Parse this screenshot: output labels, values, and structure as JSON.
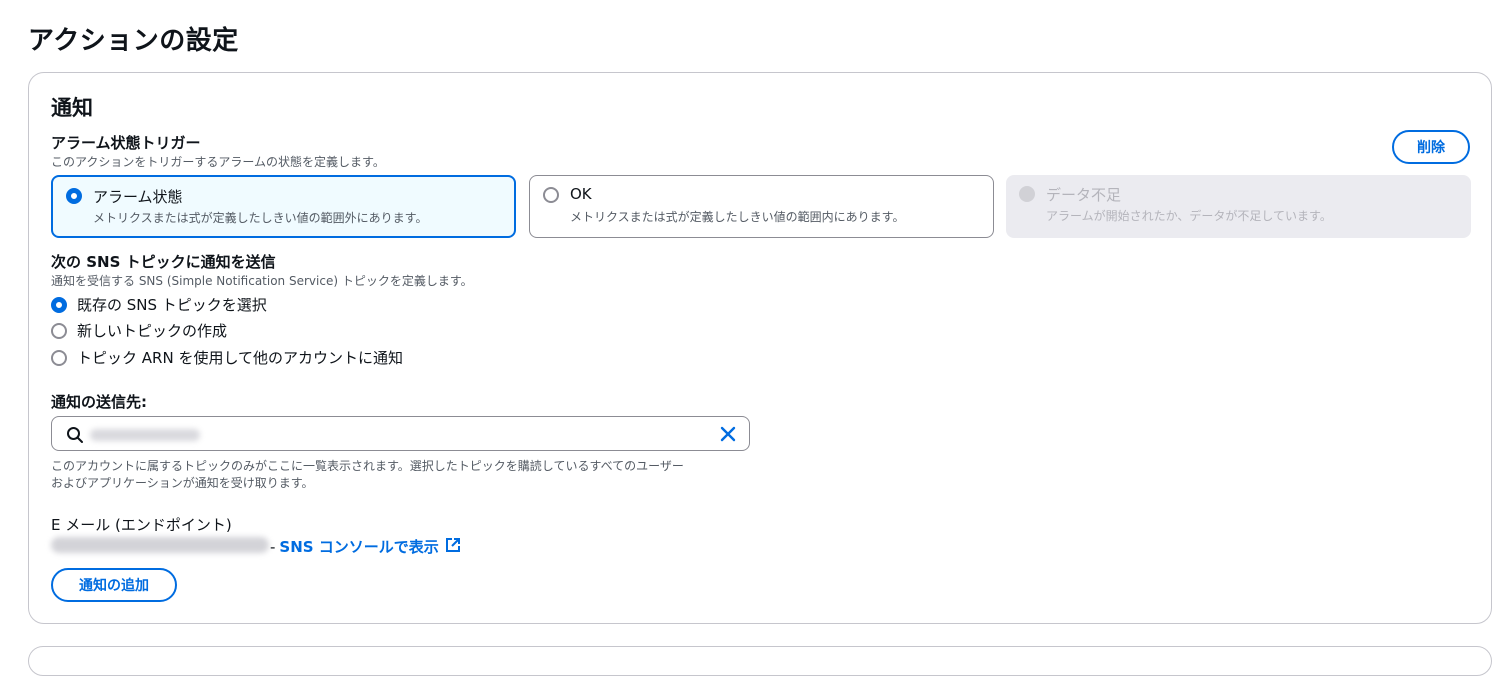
{
  "page": {
    "title": "アクションの設定"
  },
  "notification": {
    "title": "通知",
    "delete_label": "削除",
    "trigger": {
      "label": "アラーム状態トリガー",
      "description": "このアクションをトリガーするアラームの状態を定義します。",
      "options": [
        {
          "title": "アラーム状態",
          "description": "メトリクスまたは式が定義したしきい値の範囲外にあります。",
          "state": "selected"
        },
        {
          "title": "OK",
          "description": "メトリクスまたは式が定義したしきい値の範囲内にあります。",
          "state": "unselected"
        },
        {
          "title": "データ不足",
          "description": "アラームが開始されたか、データが不足しています。",
          "state": "disabled"
        }
      ]
    },
    "sns": {
      "label": "次の SNS トピックに通知を送信",
      "description": "通知を受信する SNS (Simple Notification Service) トピックを定義します。",
      "options": [
        {
          "label": "既存の SNS トピックを選択",
          "checked": true
        },
        {
          "label": "新しいトピックの作成",
          "checked": false
        },
        {
          "label": "トピック ARN を使用して他のアカウントに通知",
          "checked": false
        }
      ]
    },
    "destination": {
      "label": "通知の送信先:",
      "hint_line1": "このアカウントに属するトピックのみがここに一覧表示されます。選択したトピックを購読しているすべてのユーザー",
      "hint_line2": "およびアプリケーションが通知を受け取ります。"
    },
    "email": {
      "label": "E メール (エンドポイント)",
      "separator": "-",
      "link_text": "SNS コンソールで表示"
    },
    "add_label": "通知の追加"
  },
  "colors": {
    "accent": "#006ce0",
    "selected_bg": "#f0fbff",
    "disabled_bg": "#ebebf0"
  },
  "icons": [
    "search-icon",
    "clear-icon",
    "external-link-icon"
  ]
}
